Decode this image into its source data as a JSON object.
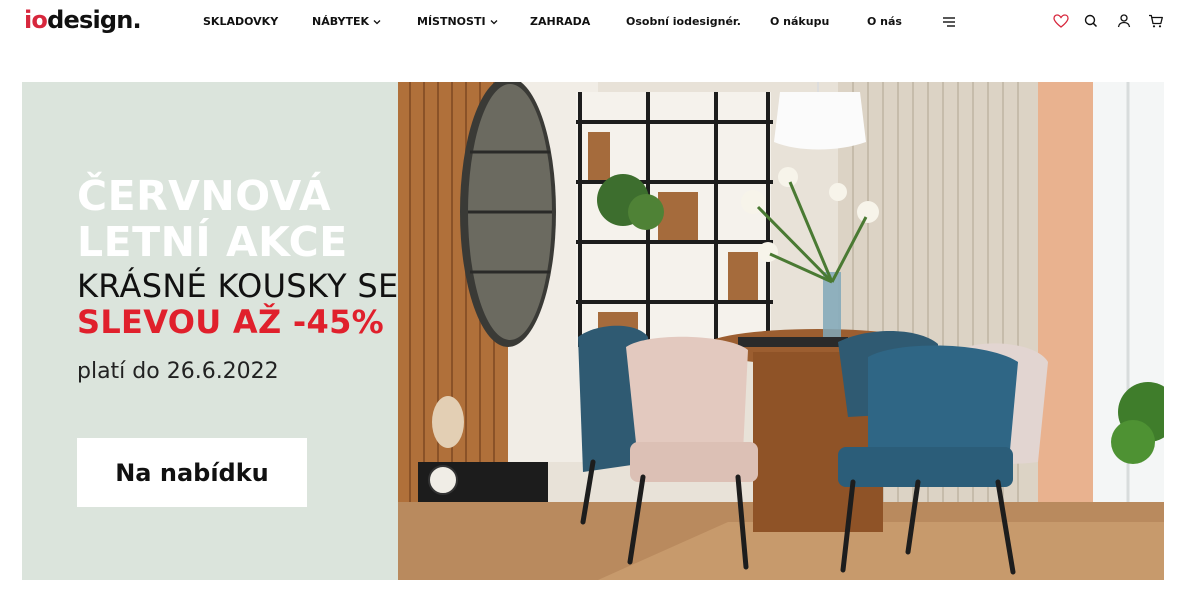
{
  "logo": {
    "part1": "io",
    "part2": "design."
  },
  "nav": {
    "items": [
      {
        "label": "SKLADOVKY"
      },
      {
        "label": "NÁBYTEK"
      },
      {
        "label": "MÍSTNOSTI"
      },
      {
        "label": "ZAHRADA"
      },
      {
        "label": "Osobní iodesignér."
      },
      {
        "label": "O nákupu"
      },
      {
        "label": "O nás"
      }
    ]
  },
  "icons": {
    "menu": "hamburger-menu-icon",
    "wishlist": "heart-icon",
    "search": "search-icon",
    "account": "user-icon",
    "cart": "cart-icon"
  },
  "banner": {
    "title_line1": "ČERVNOVÁ",
    "title_line2": "LETNÍ AKCE",
    "subtitle_line1": "KRÁSNÉ KOUSKY SE",
    "subtitle_line2": "SLEVOU AŽ -45%",
    "valid_until": "platí do 26.6.2022",
    "cta_label": "Na nabídku"
  },
  "colors": {
    "brand_red": "#d7273d",
    "sale_red": "#e0202c",
    "banner_bg": "#dbe4dc"
  }
}
